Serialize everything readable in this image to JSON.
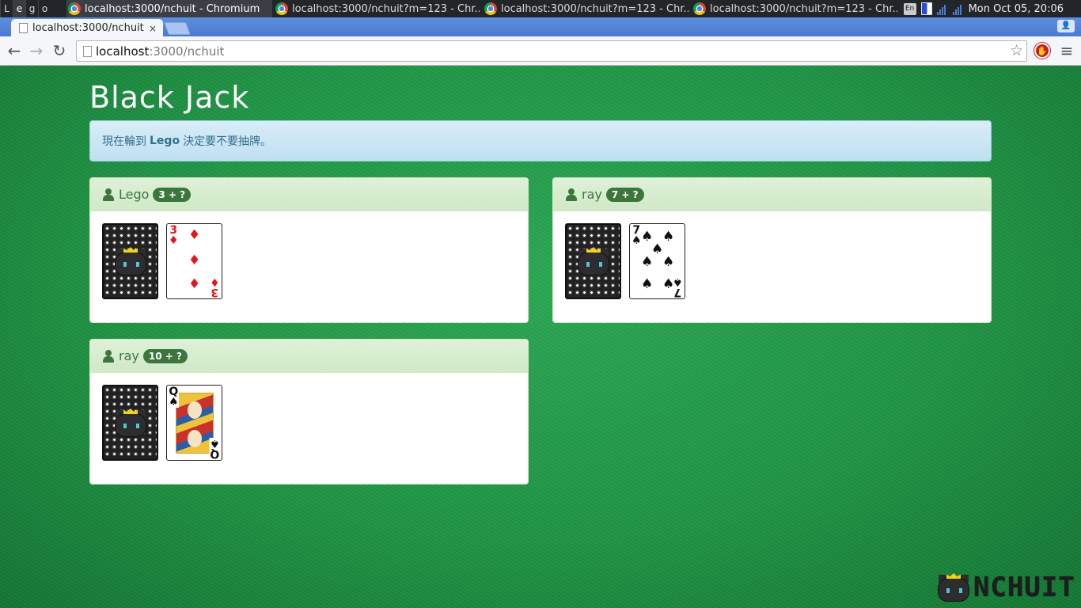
{
  "taskbar": {
    "workspace": {
      "label": "Lego",
      "letters": [
        "L",
        "e",
        "g",
        "o"
      ]
    },
    "tasks": [
      {
        "title": "localhost:3000/nchuit - Chromium",
        "active": true
      },
      {
        "title": "localhost:3000/nchuit?m=123 - Chr...",
        "active": false
      },
      {
        "title": "localhost:3000/nchuit?m=123 - Chr...",
        "active": false
      },
      {
        "title": "localhost:3000/nchuit?m=123 - Chr...",
        "active": false
      }
    ],
    "tray": {
      "keyboard": "En",
      "clock": "Mon Oct 05, 20:06"
    }
  },
  "browser": {
    "tab_title": "localhost:3000/nchuit",
    "tab_close": "×",
    "url_host": "localhost",
    "url_path": ":3000/nchuit",
    "icons": {
      "back": "←",
      "forward": "→",
      "reload": "↻",
      "star": "☆",
      "menu": "≡"
    }
  },
  "page": {
    "title": "Black Jack",
    "alert": {
      "prefix": "現在輪到",
      "player": "Lego",
      "suffix": "決定要不要抽牌。"
    },
    "players": [
      {
        "name": "Lego",
        "score": "3 + ?",
        "face_card": {
          "rank": "3",
          "suit": "♦",
          "color": "red"
        }
      },
      {
        "name": "ray",
        "score": "7 + ?",
        "face_card": {
          "rank": "7",
          "suit": "♠",
          "color": "black"
        }
      },
      {
        "name": "ray",
        "score": "10 + ?",
        "face_card": {
          "rank": "Q",
          "suit": "♠",
          "color": "black"
        }
      }
    ],
    "logo_text": "NCHUIT"
  },
  "colors": {
    "felt": "#1e8f3f",
    "panel_header": "#dff0d8",
    "badge": "#3c763d",
    "alert_bg": "#d9edf7",
    "alert_text": "#31708f"
  }
}
